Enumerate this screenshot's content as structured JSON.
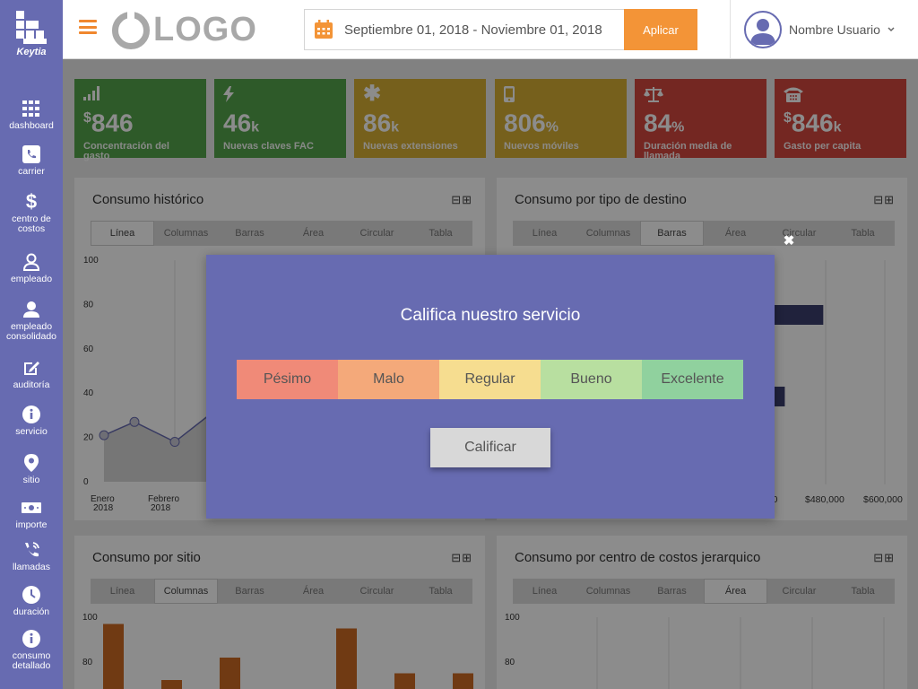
{
  "brand": {
    "name": "Keytia"
  },
  "sidebar": {
    "items": [
      {
        "label": "dashboard",
        "icon": "grid-icon"
      },
      {
        "label": "carrier",
        "icon": "phone-icon"
      },
      {
        "label": "centro de costos",
        "icon": "dollar-icon"
      },
      {
        "label": "empleado",
        "icon": "user-outline-icon"
      },
      {
        "label": "empleado consolidado",
        "icon": "user-solid-icon"
      },
      {
        "label": "auditoría",
        "icon": "edit-icon"
      },
      {
        "label": "servicio",
        "icon": "info-icon"
      },
      {
        "label": "sitio",
        "icon": "map-pin-icon"
      },
      {
        "label": "importe",
        "icon": "money-icon"
      },
      {
        "label": "llamadas",
        "icon": "phone-ring-icon"
      },
      {
        "label": "duración",
        "icon": "clock-icon"
      },
      {
        "label": "consumo detallado",
        "icon": "info-icon"
      }
    ]
  },
  "header": {
    "logo_text": "LOGO",
    "date_range": "Septiembre 01, 2018 - Noviembre 01, 2018",
    "apply_label": "Aplicar",
    "user_name": "Nombre Usuario"
  },
  "kpis": [
    {
      "prefix": "$",
      "value": "846",
      "suffix": "",
      "label": "Concentración del gasto",
      "color": "#54a54c",
      "icon": "signal-icon"
    },
    {
      "prefix": "",
      "value": "46",
      "suffix": "k",
      "label": "Nuevas claves FAC",
      "color": "#54a54c",
      "icon": "bolt-icon"
    },
    {
      "prefix": "",
      "value": "86",
      "suffix": "k",
      "label": "Nuevas extensiones",
      "color": "#d8b033",
      "icon": "asterisk-icon"
    },
    {
      "prefix": "",
      "value": "806",
      "suffix": "%",
      "label": "Nuevos móviles",
      "color": "#d8b033",
      "icon": "mobile-icon"
    },
    {
      "prefix": "",
      "value": "84",
      "suffix": "%",
      "label": "Duración media de llamada",
      "color": "#d3473e",
      "icon": "scale-icon"
    },
    {
      "prefix": "$",
      "value": "846",
      "suffix": "k",
      "label": "Gasto per capita",
      "color": "#d3473e",
      "icon": "telephone-icon"
    }
  ],
  "tabs": [
    "Línea",
    "Columnas",
    "Barras",
    "Área",
    "Circular",
    "Tabla"
  ],
  "panels": {
    "historico": {
      "title": "Consumo histórico",
      "active_tab": 0
    },
    "destino": {
      "title": "Consumo por tipo de destino",
      "active_tab": 2
    },
    "sitio": {
      "title": "Consumo por sitio",
      "active_tab": 1
    },
    "centro": {
      "title": "Consumo por centro de costos jerarquico",
      "active_tab": 3
    }
  },
  "chart_data": [
    {
      "type": "line",
      "yticks": [
        "100",
        "80",
        "60",
        "40",
        "20",
        "0"
      ],
      "x": [
        "Enero 2018",
        "Febrero 2018"
      ],
      "ylim": [
        0,
        100
      ],
      "values": [
        21,
        27,
        18,
        30
      ]
    },
    {
      "type": "bar",
      "orientation": "horizontal",
      "xticks": [
        "$360,000",
        "$480,000",
        "$600,000"
      ],
      "visible_xtick_fragment": "000",
      "values": [
        520000,
        470000
      ]
    },
    {
      "type": "bar",
      "yticks": [
        "100",
        "80"
      ],
      "ylim": [
        0,
        100
      ],
      "values": [
        97,
        72,
        82,
        null,
        95,
        75,
        75
      ]
    },
    {
      "type": "area",
      "yticks": [
        "100",
        "80"
      ],
      "ylim": [
        0,
        100
      ]
    }
  ],
  "modal": {
    "title": "Califica nuestro servicio",
    "ratings": [
      {
        "label": "Pésimo",
        "color": "#f08a78"
      },
      {
        "label": "Malo",
        "color": "#f4a97a"
      },
      {
        "label": "Regular",
        "color": "#f6dd90"
      },
      {
        "label": "Bueno",
        "color": "#b8dfa0"
      },
      {
        "label": "Excelente",
        "color": "#90d19e"
      }
    ],
    "submit_label": "Calificar",
    "close_icon": "close-icon"
  },
  "colors": {
    "sidebar": "#676bb1",
    "accent": "#f39437",
    "bar_dark": "#3b3f6d",
    "bar_orange": "#cc6a24"
  }
}
